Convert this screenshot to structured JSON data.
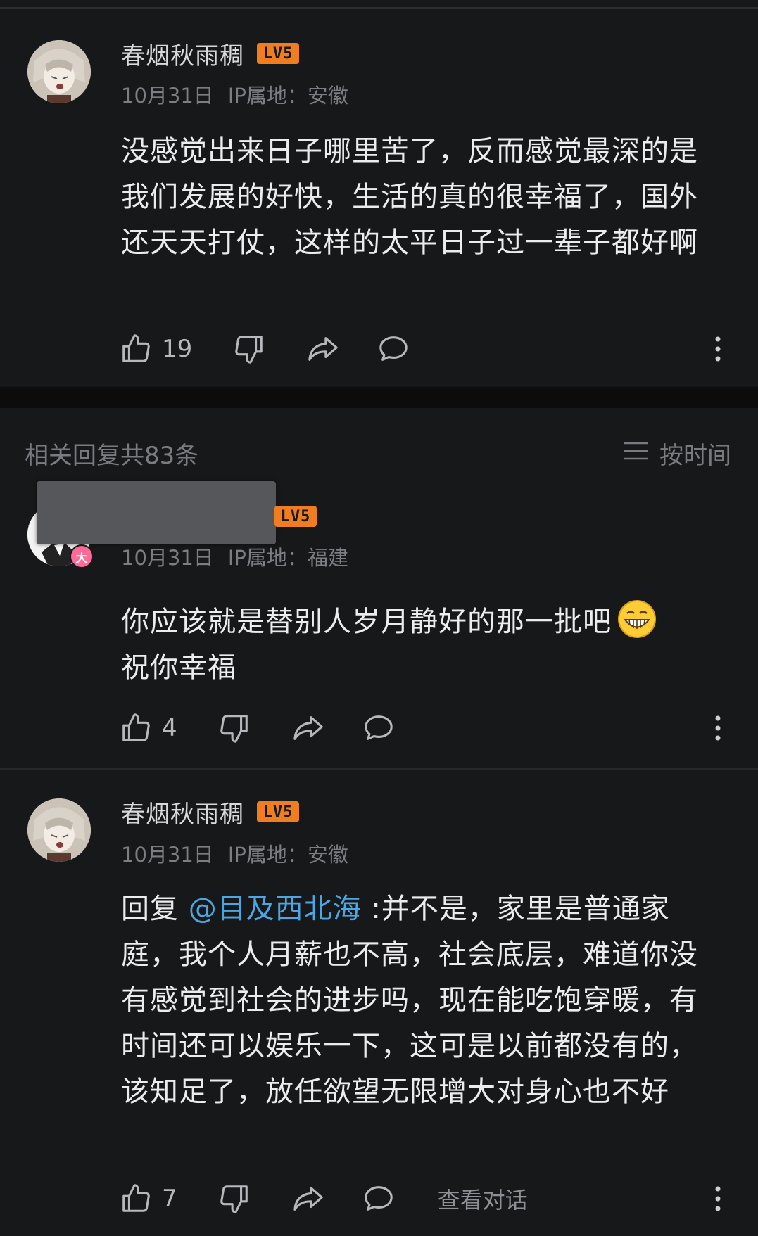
{
  "comments": [
    {
      "username": "春烟秋雨稠",
      "level": "LV5",
      "date": "10月31日",
      "ip": "IP属地：安徽",
      "text": "没感觉出来日子哪里苦了，反而感觉最深的是我们发展的好快，生活的真的很幸福了，国外还天天打仗，这样的太平日子过一辈子都好啊",
      "likes": "19"
    }
  ],
  "replies_section": {
    "header": "相关回复共83条",
    "sort_label": "按时间"
  },
  "replies": [
    {
      "username": "",
      "level": "LV5",
      "badge": "大",
      "date": "10月31日",
      "ip": "IP属地：福建",
      "text": "你应该就是替别人岁月静好的那一批吧",
      "text_line2": "祝你幸福",
      "likes": "4",
      "emoji": "grinning-face-emoji"
    },
    {
      "username": "春烟秋雨稠",
      "level": "LV5",
      "date": "10月31日",
      "ip": "IP属地：安徽",
      "reply_prefix": "回复 ",
      "mention": "@目及西北海",
      "text": " :并不是，家里是普通家庭，我个人月薪也不高，社会底层，难道你没有感觉到社会的进步吗，现在能吃饱穿暖，有时间还可以娱乐一下，这可是以前都没有的，该知足了，放任欲望无限增大对身心也不好",
      "likes": "7",
      "view_dialog": "查看对话"
    }
  ],
  "icons": [
    "like-icon",
    "dislike-icon",
    "share-icon",
    "comment-icon",
    "more-icon",
    "sort-icon"
  ],
  "colors": {
    "background": "#17181a",
    "level_badge": "#f07d1f",
    "mention": "#4aa7e3",
    "meta": "#7d7e83"
  }
}
